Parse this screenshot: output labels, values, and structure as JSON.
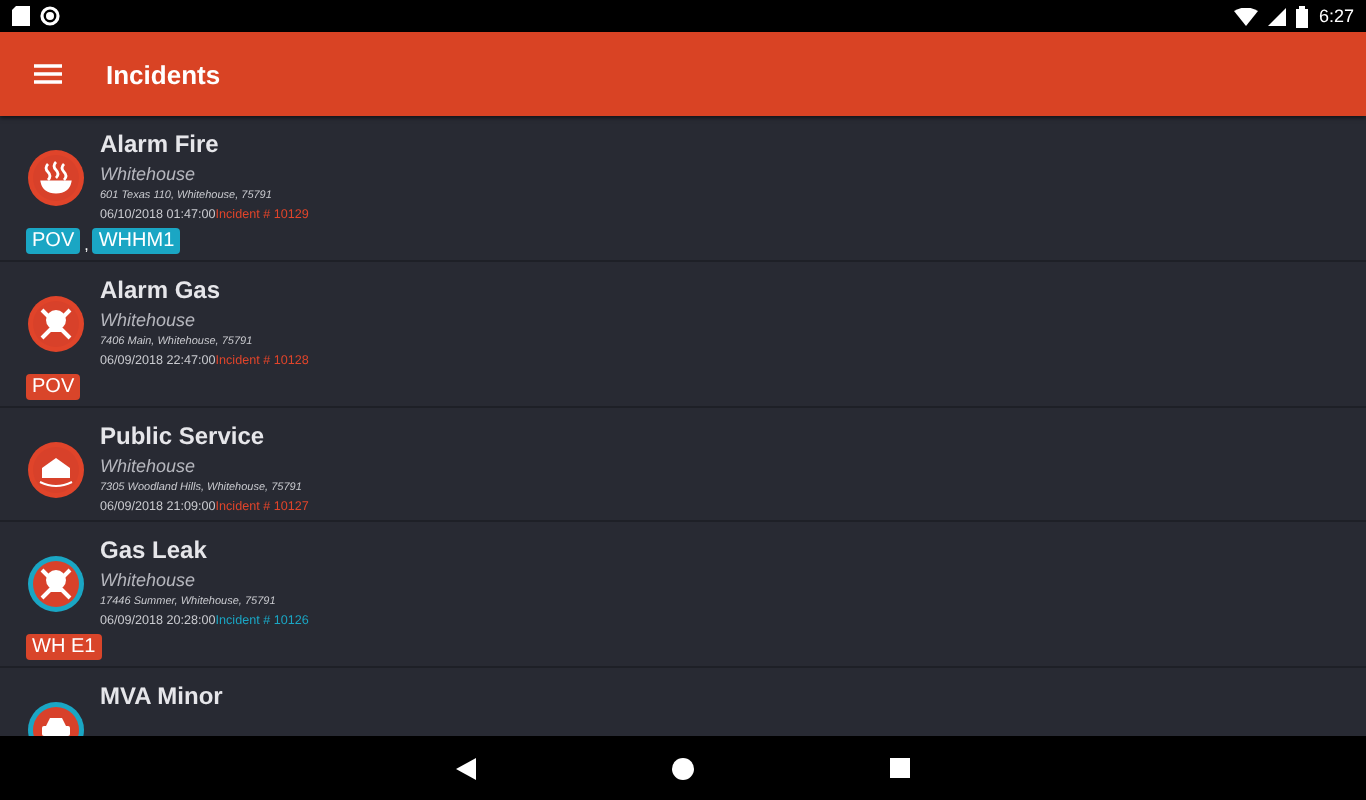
{
  "status_bar": {
    "time": "6:27"
  },
  "app_bar": {
    "title": "Incidents"
  },
  "incidents": [
    {
      "kind": "fire",
      "color": "#e0442a",
      "title": "Alarm Fire",
      "city": "Whitehouse",
      "address": "601 Texas 110, Whitehouse, 75791",
      "datetime": "06/10/2018 01:47:00",
      "incident": "Incident # 10129",
      "tag_separator": ",",
      "tags": [
        {
          "label": "POV",
          "color": "#1aa6c4"
        },
        {
          "label": "WHHM1",
          "color": "#1aa6c4"
        }
      ]
    },
    {
      "kind": "skull",
      "color": "#e0442a",
      "title": "Alarm Gas",
      "city": "Whitehouse",
      "address": "7406 Main, Whitehouse, 75791",
      "datetime": "06/09/2018 22:47:00",
      "incident": "Incident # 10128",
      "tags": [
        {
          "label": "POV",
          "color": "#d9452a"
        }
      ]
    },
    {
      "kind": "service",
      "color": "#e0442a",
      "title": "Public Service",
      "city": "Whitehouse",
      "address": "7305 Woodland Hills, Whitehouse, 75791",
      "datetime": "06/09/2018 21:09:00",
      "incident": "Incident # 10127"
    },
    {
      "kind": "skull",
      "color": "#1aa6c4",
      "title": "Gas Leak",
      "city": "Whitehouse",
      "address": "17446 Summer, Whitehouse, 75791",
      "datetime": "06/09/2018 20:28:00",
      "incident": "Incident # 10126",
      "tags": [
        {
          "label": "WH E1",
          "color": "#d9452a"
        }
      ]
    },
    {
      "kind": "car",
      "color": "#1aa6c4",
      "title": "MVA Minor"
    }
  ]
}
